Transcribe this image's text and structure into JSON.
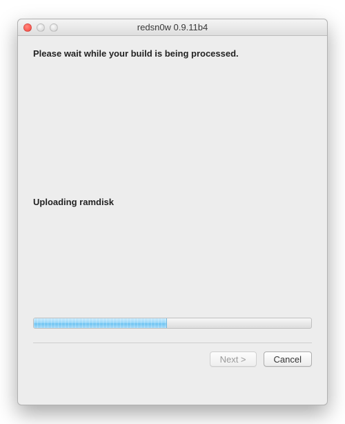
{
  "window": {
    "title": "redsn0w 0.9.11b4"
  },
  "content": {
    "message": "Please wait while your build is being processed.",
    "status": "Uploading ramdisk"
  },
  "progress": {
    "percent": 48
  },
  "buttons": {
    "next_label": "Next >",
    "cancel_label": "Cancel"
  }
}
